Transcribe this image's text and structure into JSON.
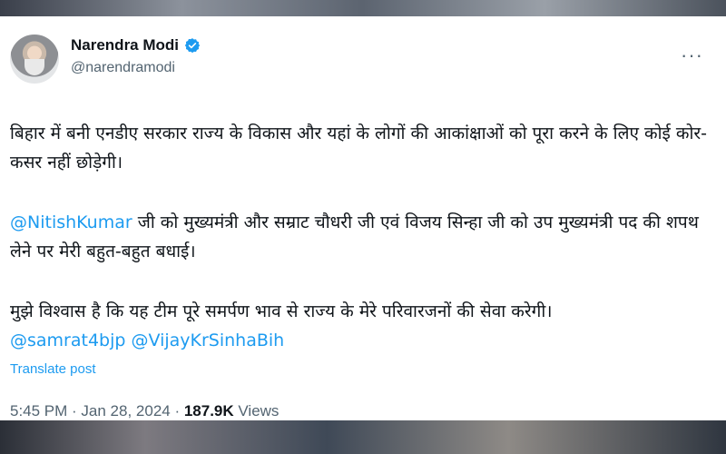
{
  "author": {
    "name": "Narendra Modi",
    "handle": "@narendramodi",
    "verified_icon": "verified-badge-icon",
    "accent_color": "#1d9bf0"
  },
  "menu": {
    "more_glyph": "···"
  },
  "post": {
    "para1": "बिहार में बनी एनडीए सरकार राज्य के विकास और यहां के लोगों की आकांक्षाओं को पूरा करने के लिए कोई कोर-कसर नहीं छोड़ेगी।",
    "para2_mention": "@NitishKumar",
    "para2_text": " जी को मुख्यमंत्री और सम्राट चौधरी जी एवं विजय सिन्हा जी को उप मुख्यमंत्री पद की शपथ लेने पर मेरी बहुत-बहुत बधाई।",
    "para3": "मुझे विश्वास है कि यह टीम पूरे समर्पण भाव से राज्य के मेरे परिवारजनों की सेवा करेगी।",
    "mention_1": "@samrat4bjp",
    "mention_2": "@VijayKrSinhaBih",
    "translate_label": "Translate post"
  },
  "meta": {
    "time": "5:45 PM",
    "separator_1": " · ",
    "date": "Jan 28, 2024",
    "separator_2": " · ",
    "views_count": "187.9K",
    "views_label": " Views"
  }
}
